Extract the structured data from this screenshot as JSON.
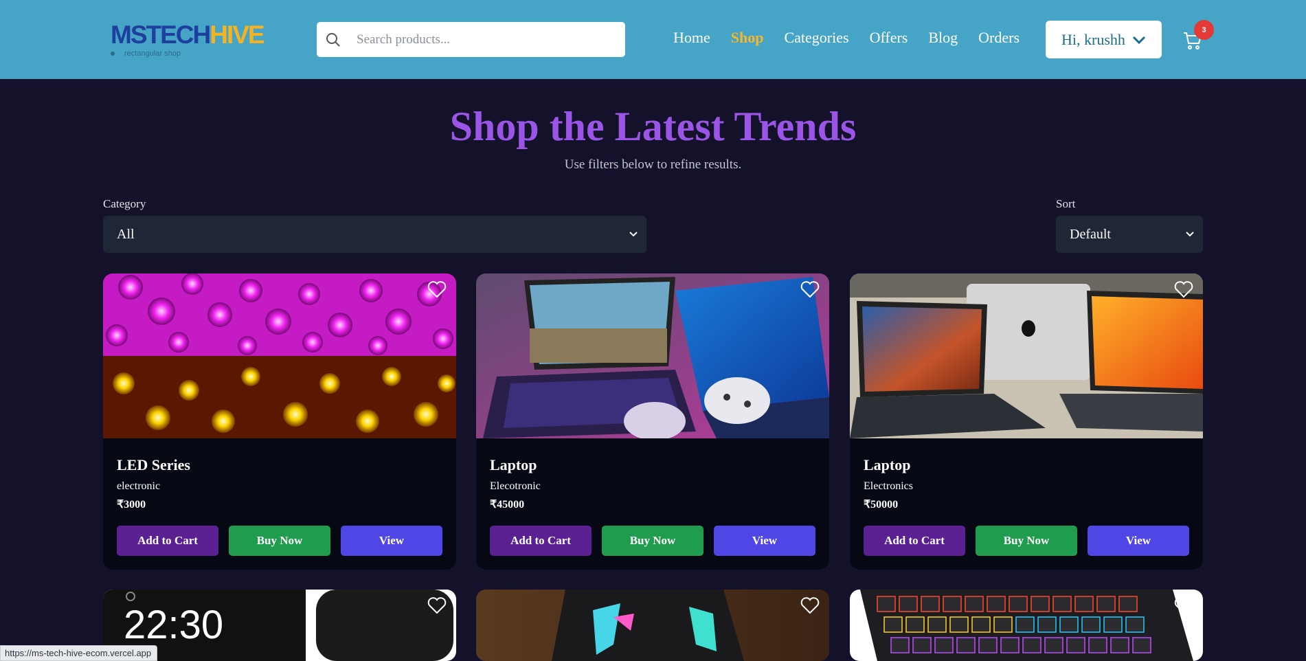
{
  "brand": {
    "name_part1": "MSTECH",
    "name_part2": "HIVE",
    "tagline": "rectangular shop"
  },
  "search": {
    "placeholder": "Search products..."
  },
  "nav": {
    "links": [
      {
        "label": "Home",
        "active": false
      },
      {
        "label": "Shop",
        "active": true
      },
      {
        "label": "Categories",
        "active": false
      },
      {
        "label": "Offers",
        "active": false
      },
      {
        "label": "Blog",
        "active": false
      },
      {
        "label": "Orders",
        "active": false
      }
    ],
    "user_greeting": "Hi, krushh",
    "cart_count": "3"
  },
  "hero": {
    "title": "Shop the Latest Trends",
    "subtitle": "Use filters below to refine results."
  },
  "filters": {
    "category_label": "Category",
    "category_value": "All",
    "sort_label": "Sort",
    "sort_value": "Default"
  },
  "products": [
    {
      "name": "LED Series",
      "category": "electronic",
      "price": "₹3000",
      "image": "led-lights-image"
    },
    {
      "name": "Laptop",
      "category": "Elecotronic",
      "price": "₹45000",
      "image": "gaming-laptops-image"
    },
    {
      "name": "Laptop",
      "category": "Electronics",
      "price": "₹50000",
      "image": "macbooks-image"
    },
    {
      "name": "",
      "category": "",
      "price": "",
      "image": "smartwatch-image",
      "clock": "22:30"
    },
    {
      "name": "",
      "category": "",
      "price": "",
      "image": "gaming-mouse-image"
    },
    {
      "name": "",
      "category": "",
      "price": "",
      "image": "rgb-keyboard-image"
    }
  ],
  "buttons": {
    "add_to_cart": "Add to Cart",
    "buy_now": "Buy Now",
    "view": "View"
  },
  "status_bar_url": "https://ms-tech-hive-ecom.vercel.app",
  "colors": {
    "navbar_bg": "#46a5c6",
    "page_bg": "#14122a",
    "accent_purple": "#9b55e6",
    "active_nav": "#f4b62d",
    "btn_cart": "#5b2192",
    "btn_buy": "#1f9c4d",
    "btn_view": "#4f46e5"
  }
}
